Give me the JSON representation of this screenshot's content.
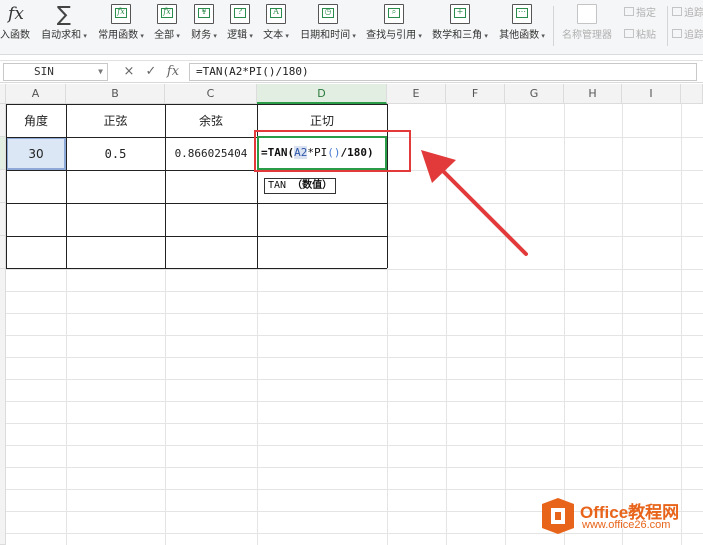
{
  "ribbon": {
    "items": [
      {
        "label": "入函数",
        "icon": "fx-icon",
        "arrow": false
      },
      {
        "label": "自动求和",
        "icon": "sigma-icon",
        "arrow": true
      },
      {
        "label": "常用函数",
        "icon": "function-star-icon",
        "arrow": true
      },
      {
        "label": "全部",
        "icon": "function-box-icon",
        "arrow": true
      },
      {
        "label": "财务",
        "icon": "currency-icon",
        "arrow": true
      },
      {
        "label": "逻辑",
        "icon": "question-book-icon",
        "arrow": true
      },
      {
        "label": "文本",
        "icon": "text-a-icon",
        "arrow": true
      },
      {
        "label": "日期和时间",
        "icon": "clock-icon",
        "arrow": true
      },
      {
        "label": "查找与引用",
        "icon": "search-book-icon",
        "arrow": true
      },
      {
        "label": "数学和三角",
        "icon": "math-icon",
        "arrow": true
      },
      {
        "label": "其他函数",
        "icon": "more-functions-icon",
        "arrow": true
      }
    ],
    "disabled": {
      "name_manager": "名称管理器",
      "specify": "指定",
      "paste": "粘贴",
      "trace1": "追踪",
      "trace2": "追踪"
    }
  },
  "formula_bar": {
    "name_box": "SIN",
    "cancel_icon": "×",
    "confirm_icon": "✓",
    "fx_label": "fx",
    "formula": "=TAN(A2*PI()/180)"
  },
  "columns": [
    "A",
    "B",
    "C",
    "D",
    "E",
    "F",
    "G",
    "H",
    "I"
  ],
  "table": {
    "headers": [
      "角度",
      "正弦",
      "余弦",
      "正切"
    ],
    "row1": [
      "30",
      "0.5",
      "0.866025404"
    ]
  },
  "editing": {
    "prefix": "=TAN(",
    "ref": "A2",
    "middle": "*PI",
    "paren_open": "(",
    "paren_close": ")",
    "suffix": "/180)"
  },
  "tooltip": {
    "func": "TAN",
    "arg": "（数值）"
  },
  "watermark": {
    "brand": "Office教程网",
    "url": "www.office26.com"
  },
  "colors": {
    "accent_green": "#2a9c48",
    "annotation_red": "#e23a3a",
    "logo_orange": "#e8641a"
  }
}
